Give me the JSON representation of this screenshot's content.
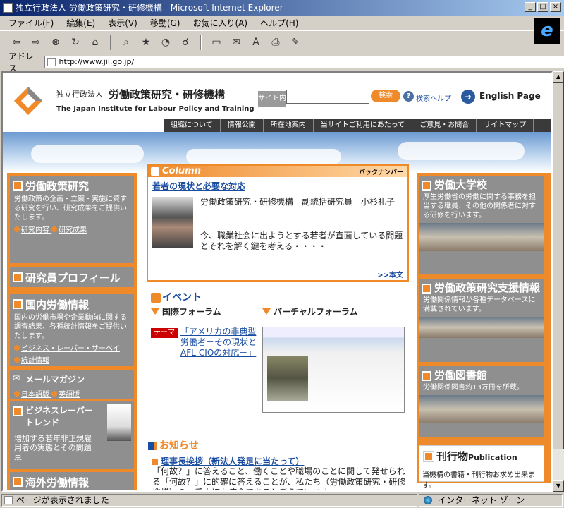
{
  "window": {
    "title": "独立行政法人 労働政策研究・研修機構 - Microsoft Internet Explorer",
    "buttons": [
      "_",
      "□",
      "×"
    ]
  },
  "menu": [
    "ファイル(F)",
    "編集(E)",
    "表示(V)",
    "移動(G)",
    "お気に入り(A)",
    "ヘルプ(H)"
  ],
  "address": {
    "label": "アドレス",
    "url": "http://www.jil.go.jp/"
  },
  "status": {
    "text": "ページが表示されました",
    "zone": "インターネット ゾーン"
  },
  "header": {
    "org_small": "独立行政法人",
    "org_big": "労働政策研究・研修機構",
    "org_en": "The Japan Institute for Labour Policy and Training",
    "search_label": "サイト内",
    "search_button": "検索",
    "help": "検索ヘルプ",
    "english": "English Page"
  },
  "nav": [
    "組織について",
    "情報公開",
    "所在地案内",
    "当サイトご利用にあたって",
    "ご意見・お問合",
    "サイトマップ"
  ],
  "left": {
    "research": {
      "title": "労働政策研究",
      "text": "労働政策の企画・立案・実施に資する研究を行い、研究成果をご提供いたします。",
      "links": [
        "研究内容",
        "研究成果"
      ]
    },
    "profile": {
      "title": "研究員プロフィール"
    },
    "domestic": {
      "title": "国内労働情報",
      "text": "国内の労働市場や企業動向に関する調査結果、各種統計情報をご提供いたします。",
      "links": [
        "ビジネス・レーバー・サーベイ",
        "統計情報"
      ]
    },
    "mail": {
      "title": "メールマガジン",
      "links": [
        "日本語版",
        "英語版"
      ]
    },
    "blt": {
      "title": "ビジネスレーバートレンド",
      "text": "増加する若年非正規雇用者の実態とその問題点"
    },
    "foreign": {
      "title": "海外労働情報"
    }
  },
  "column": {
    "label": "Column",
    "backnumber": "バックナンバー",
    "title": "若者の現状と必要な対応",
    "author": "労働政策研究・研修機構　副統括研究員　小杉礼子",
    "body": "今、職業社会に出ようとする若者が直面している問題とそれを解く鍵を考える・・・・",
    "more": ">>本文"
  },
  "events": {
    "title": "イベント",
    "forum1": "国際フォーラム",
    "forum2": "バーチャルフォーラム",
    "theme_tag": "テーマ",
    "theme_link": "「アメリカの非典型労働者－その現状とAFL-CIOの対応－」"
  },
  "news": {
    "title": "お知らせ",
    "item_title": "理事長挨拶（新法人発足に当たって）",
    "item_body": "「何故？」に答えること、働くことや職場のことに関して発せられる「何故？」に的確に答えることが、私たち（労働政策研究・研修機構）の一番大切な使命であると考えています。"
  },
  "right": {
    "univ": {
      "title": "労働大学校",
      "text": "厚生労働省の労働に関する事務を担当する職員、その他の関係者に対する研修を行います。"
    },
    "support": {
      "title": "労働政策研究支援情報",
      "text": "労働関係情報が各種データベースに満載されています。"
    },
    "library": {
      "title": "労働図書館",
      "text": "労働関係図書約13万冊を所蔵。"
    },
    "pub": {
      "title": "刊行物",
      "title_en": "Publication",
      "text": "当機構の書籍・刊行物お求め出来ます。"
    }
  }
}
